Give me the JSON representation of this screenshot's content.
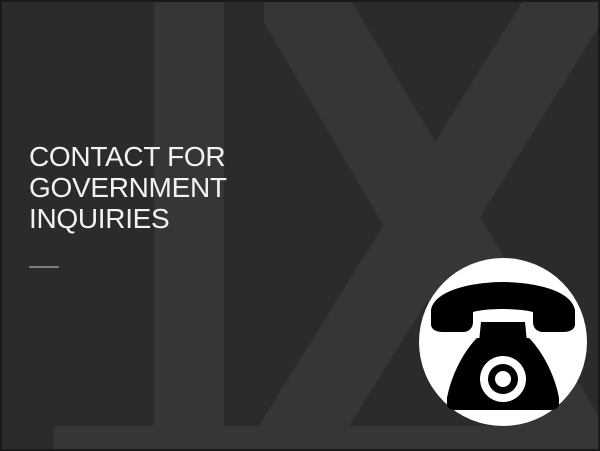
{
  "slide": {
    "title_lines": [
      "CONTACT FOR",
      "GOVERNMENT",
      "INQUIRIES"
    ],
    "watermark_text": "IX",
    "icon": "telephone-icon",
    "colors": {
      "background": "#2b2b2b",
      "watermark": "#363636",
      "title": "#f2f2f2",
      "accent_rule": "#7f7f7f",
      "icon_badge": "#ffffff",
      "icon": "#000000"
    }
  }
}
